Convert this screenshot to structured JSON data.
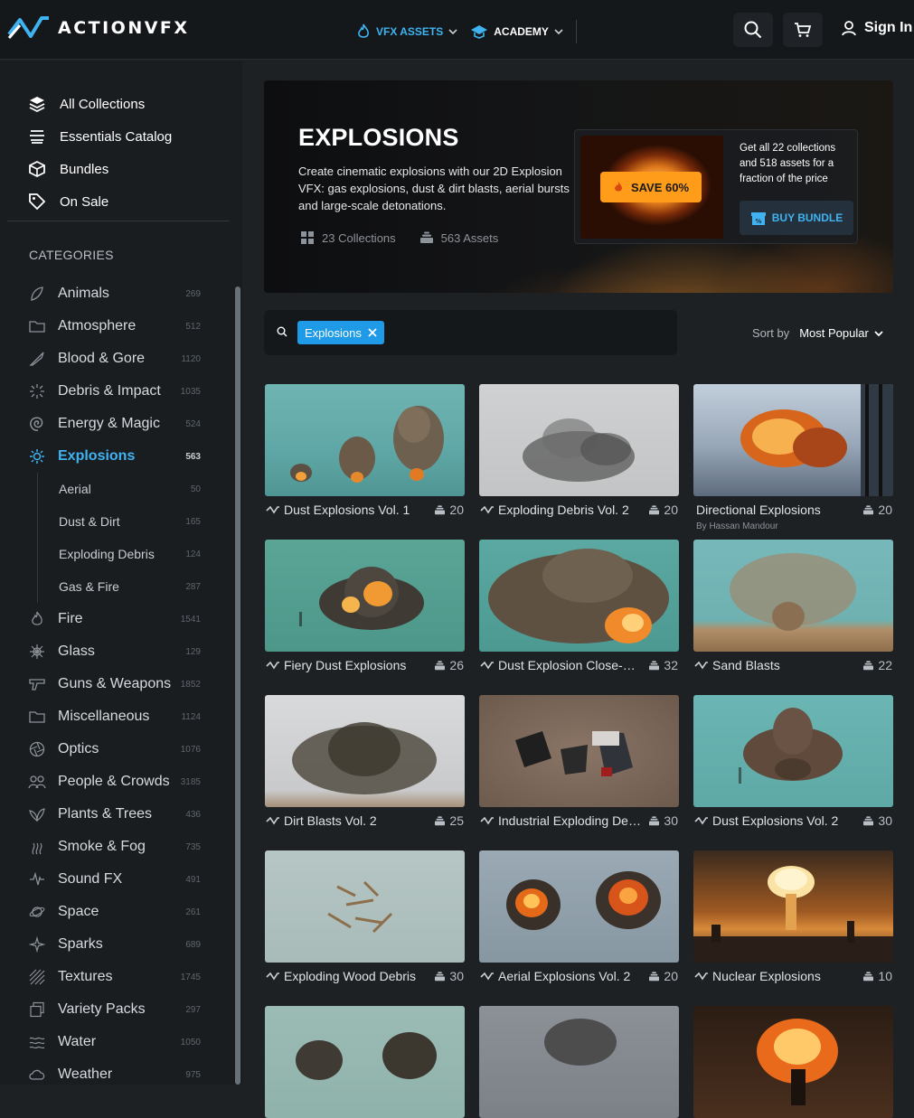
{
  "brand": {
    "name": "ACTIONVFX"
  },
  "topnav": {
    "vfx_assets": "VFX ASSETS",
    "academy": "ACADEMY",
    "sign_in": "Sign In"
  },
  "sidebar": {
    "top_links": [
      {
        "label": "All Collections",
        "icon": "layers-icon"
      },
      {
        "label": "Essentials Catalog",
        "icon": "catalog-icon"
      },
      {
        "label": "Bundles",
        "icon": "box-icon"
      },
      {
        "label": "On Sale",
        "icon": "tag-icon"
      }
    ],
    "categories_heading": "CATEGORIES",
    "categories": [
      {
        "label": "Animals",
        "count": "269",
        "icon": "animal-icon"
      },
      {
        "label": "Atmosphere",
        "count": "512",
        "icon": "folder-icon"
      },
      {
        "label": "Blood & Gore",
        "count": "1120",
        "icon": "blade-icon"
      },
      {
        "label": "Debris & Impact",
        "count": "1035",
        "icon": "burst-icon"
      },
      {
        "label": "Energy & Magic",
        "count": "524",
        "icon": "swirl-icon"
      },
      {
        "label": "Explosions",
        "count": "563",
        "icon": "explosion-icon",
        "active": true
      },
      {
        "label": "Fire",
        "count": "1541",
        "icon": "fire-icon"
      },
      {
        "label": "Glass",
        "count": "129",
        "icon": "glass-icon"
      },
      {
        "label": "Guns & Weapons",
        "count": "1852",
        "icon": "gun-icon"
      },
      {
        "label": "Miscellaneous",
        "count": "1124",
        "icon": "folder-icon"
      },
      {
        "label": "Optics",
        "count": "1076",
        "icon": "aperture-icon"
      },
      {
        "label": "People & Crowds",
        "count": "3185",
        "icon": "people-icon"
      },
      {
        "label": "Plants & Trees",
        "count": "436",
        "icon": "leaf-icon"
      },
      {
        "label": "Smoke & Fog",
        "count": "735",
        "icon": "smoke-icon"
      },
      {
        "label": "Sound FX",
        "count": "491",
        "icon": "waveform-icon"
      },
      {
        "label": "Space",
        "count": "261",
        "icon": "planet-icon"
      },
      {
        "label": "Sparks",
        "count": "689",
        "icon": "sparkle-icon"
      },
      {
        "label": "Textures",
        "count": "1745",
        "icon": "texture-icon"
      },
      {
        "label": "Variety Packs",
        "count": "297",
        "icon": "packs-icon"
      },
      {
        "label": "Water",
        "count": "1050",
        "icon": "wave-icon"
      },
      {
        "label": "Weather",
        "count": "975",
        "icon": "cloud-icon"
      }
    ],
    "subcategories": [
      {
        "label": "Aerial",
        "count": "50"
      },
      {
        "label": "Dust & Dirt",
        "count": "165"
      },
      {
        "label": "Exploding Debris",
        "count": "124"
      },
      {
        "label": "Gas & Fire",
        "count": "287"
      }
    ]
  },
  "hero": {
    "title": "EXPLOSIONS",
    "description": "Create cinematic explosions with our 2D Explosion VFX: gas explosions, dust & dirt blasts, aerial bursts and large-scale detonations.",
    "collections": "23 Collections",
    "assets": "563 Assets",
    "promo": {
      "badge": "SAVE 60%",
      "text": "Get all 22 collections and 518 assets for a fraction of the price",
      "button": "BUY BUNDLE"
    }
  },
  "filter": {
    "tag": "Explosions",
    "sort_label": "Sort by",
    "sort_value": "Most Popular"
  },
  "colors": {
    "accent": "#3fb3f2",
    "tag_bg": "#1e9ae6",
    "save_badge": "#ff9c1a",
    "background": "#1e2124"
  },
  "products": [
    {
      "title": "Dust Explosions Vol. 1",
      "count": "20"
    },
    {
      "title": "Exploding Debris Vol. 2",
      "count": "20"
    },
    {
      "title": "Directional Explosions",
      "count": "20",
      "author": "By Hassan Mandour"
    },
    {
      "title": "Fiery Dust Explosions",
      "count": "26"
    },
    {
      "title": "Dust Explosion Close-Ups",
      "count": "32"
    },
    {
      "title": "Sand Blasts",
      "count": "22"
    },
    {
      "title": "Dirt Blasts Vol. 2",
      "count": "25"
    },
    {
      "title": "Industrial Exploding Debris",
      "count": "30"
    },
    {
      "title": "Dust Explosions Vol. 2",
      "count": "30"
    },
    {
      "title": "Exploding Wood Debris",
      "count": "30"
    },
    {
      "title": "Aerial Explosions Vol. 2",
      "count": "20"
    },
    {
      "title": "Nuclear Explosions",
      "count": "10"
    }
  ]
}
